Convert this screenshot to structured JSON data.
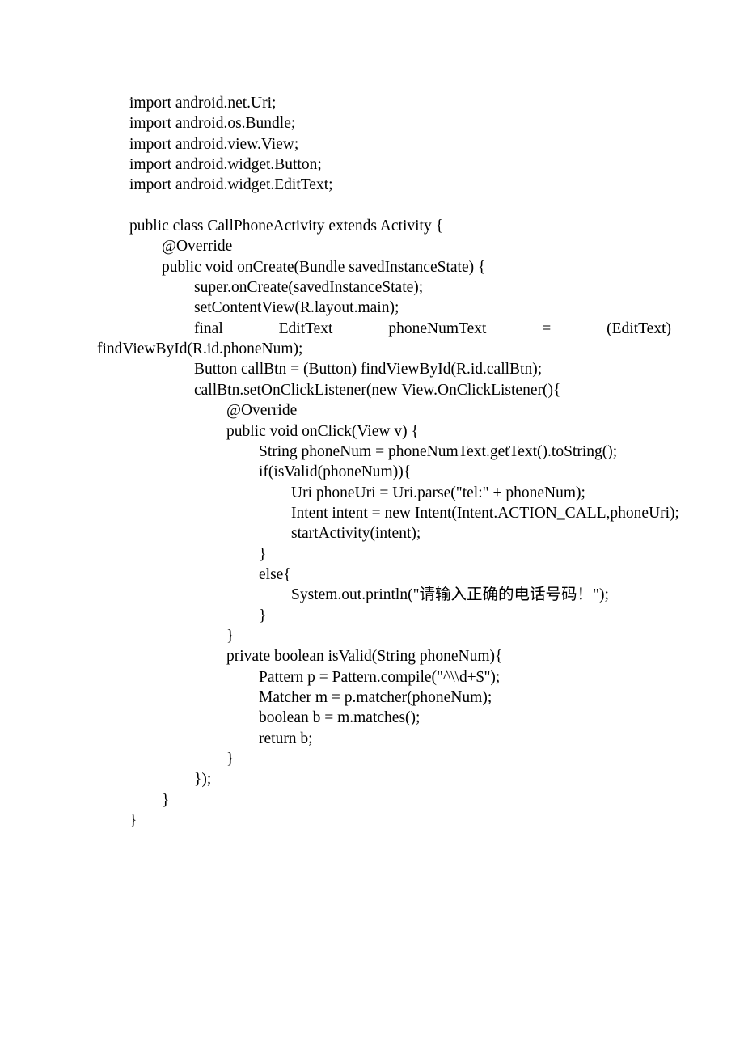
{
  "lines": [
    {
      "indent": 0,
      "text": "import android.net.Uri;"
    },
    {
      "indent": 0,
      "text": "import android.os.Bundle;"
    },
    {
      "indent": 0,
      "text": "import android.view.View;"
    },
    {
      "indent": 0,
      "text": "import android.widget.Button;"
    },
    {
      "indent": 0,
      "text": "import android.widget.EditText;"
    },
    {
      "indent": 0,
      "text": ""
    },
    {
      "indent": 0,
      "text": "public class CallPhoneActivity extends Activity {"
    },
    {
      "indent": 1,
      "text": "@Override"
    },
    {
      "indent": 1,
      "text": "public void onCreate(Bundle savedInstanceState) {"
    },
    {
      "indent": 2,
      "text": "super.onCreate(savedInstanceState);"
    },
    {
      "indent": 2,
      "text": "setContentView(R.layout.main);"
    },
    {
      "indent": 2,
      "justified": true,
      "tokens": [
        "final",
        "EditText",
        "phoneNumText",
        "=",
        "(EditText)"
      ]
    },
    {
      "indent": -1,
      "text": "findViewById(R.id.phoneNum);"
    },
    {
      "indent": 2,
      "text": "Button callBtn = (Button) findViewById(R.id.callBtn);"
    },
    {
      "indent": 2,
      "text": "callBtn.setOnClickListener(new View.OnClickListener(){"
    },
    {
      "indent": 3,
      "text": "@Override"
    },
    {
      "indent": 3,
      "text": "public void onClick(View v) {"
    },
    {
      "indent": 4,
      "text": "String phoneNum = phoneNumText.getText().toString();"
    },
    {
      "indent": 4,
      "text": "if(isValid(phoneNum)){"
    },
    {
      "indent": 5,
      "text": "Uri phoneUri = Uri.parse(\"tel:\" + phoneNum);"
    },
    {
      "indent": 5,
      "text": "Intent intent = new Intent(Intent.ACTION_CALL,phoneUri);"
    },
    {
      "indent": 5,
      "text": "startActivity(intent);"
    },
    {
      "indent": 4,
      "text": "}"
    },
    {
      "indent": 4,
      "text": "else{"
    },
    {
      "indent": 5,
      "text": "System.out.println(\"请输入正确的电话号码！\");"
    },
    {
      "indent": 4,
      "text": "}"
    },
    {
      "indent": 3,
      "text": "}"
    },
    {
      "indent": 3,
      "text": "private boolean isValid(String phoneNum){"
    },
    {
      "indent": 4,
      "text": "Pattern p = Pattern.compile(\"^\\\\d+$\");"
    },
    {
      "indent": 4,
      "text": "Matcher m = p.matcher(phoneNum);"
    },
    {
      "indent": 4,
      "text": "boolean b = m.matches();"
    },
    {
      "indent": 4,
      "text": "return b;"
    },
    {
      "indent": 3,
      "text": "}"
    },
    {
      "indent": 2,
      "text": "});"
    },
    {
      "indent": 1,
      "text": "}"
    },
    {
      "indent": 0,
      "text": "}"
    }
  ],
  "indentBase": 40,
  "indentStep": 40,
  "wrapIndent": 0
}
